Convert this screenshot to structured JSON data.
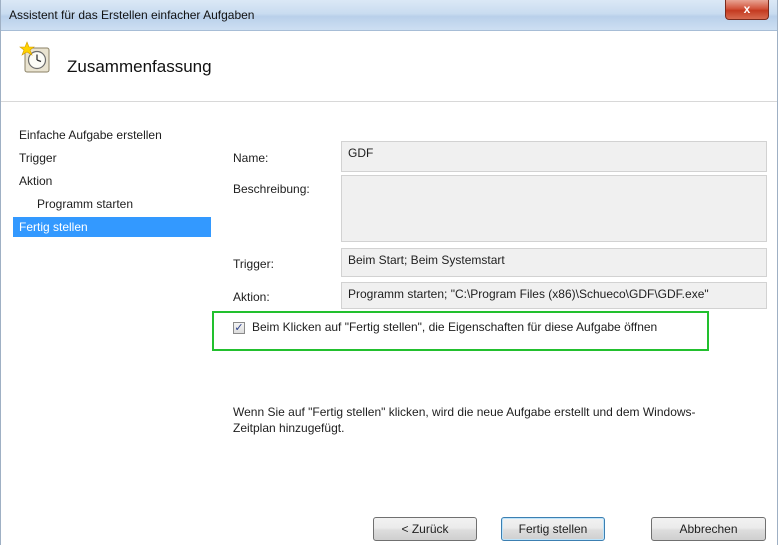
{
  "window": {
    "title": "Assistent für das Erstellen einfacher Aufgaben",
    "close_label": "x"
  },
  "header": {
    "title": "Zusammenfassung",
    "icon": "task-scheduler-clock-icon"
  },
  "nav": {
    "items": [
      {
        "label": "Einfache Aufgabe erstellen"
      },
      {
        "label": "Trigger"
      },
      {
        "label": "Aktion"
      },
      {
        "label": "Programm starten"
      },
      {
        "label": "Fertig stellen"
      }
    ]
  },
  "form": {
    "name_label": "Name:",
    "name_value": "GDF",
    "description_label": "Beschreibung:",
    "description_value": "",
    "trigger_label": "Trigger:",
    "trigger_value": "Beim Start; Beim Systemstart",
    "action_label": "Aktion:",
    "action_value": "Programm starten; \"C:\\Program Files (x86)\\Schueco\\GDF\\GDF.exe\""
  },
  "checkbox": {
    "checked": true,
    "label": "Beim Klicken auf \"Fertig stellen\", die Eigenschaften für diese Aufgabe öffnen"
  },
  "info_text": "Wenn Sie auf \"Fertig stellen\" klicken, wird die neue Aufgabe erstellt und dem Windows-Zeitplan hinzugefügt.",
  "buttons": {
    "back": "< Zurück",
    "finish": "Fertig stellen",
    "cancel": "Abbrechen"
  },
  "colors": {
    "highlight": "#3399ff",
    "callout_border": "#22c02e"
  }
}
